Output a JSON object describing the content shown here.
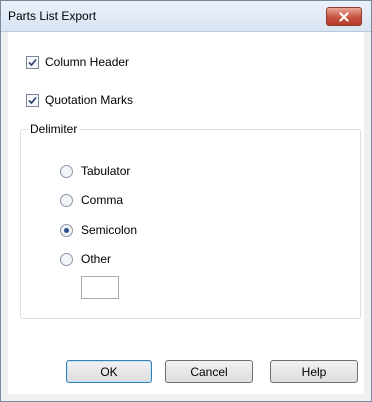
{
  "window": {
    "title": "Parts List Export"
  },
  "options": [
    {
      "label": "Column Header",
      "checked": true
    },
    {
      "label": "Quotation Marks",
      "checked": true
    }
  ],
  "delimiter": {
    "label": "Delimiter",
    "choices": [
      {
        "label": "Tabulator",
        "selected": false
      },
      {
        "label": "Comma",
        "selected": false
      },
      {
        "label": "Semicolon",
        "selected": true
      },
      {
        "label": "Other",
        "selected": false
      }
    ],
    "other_value": ""
  },
  "buttons": {
    "ok": "OK",
    "cancel": "Cancel",
    "help": "Help"
  },
  "icons": {
    "close": "close-icon",
    "check": "check-icon"
  }
}
